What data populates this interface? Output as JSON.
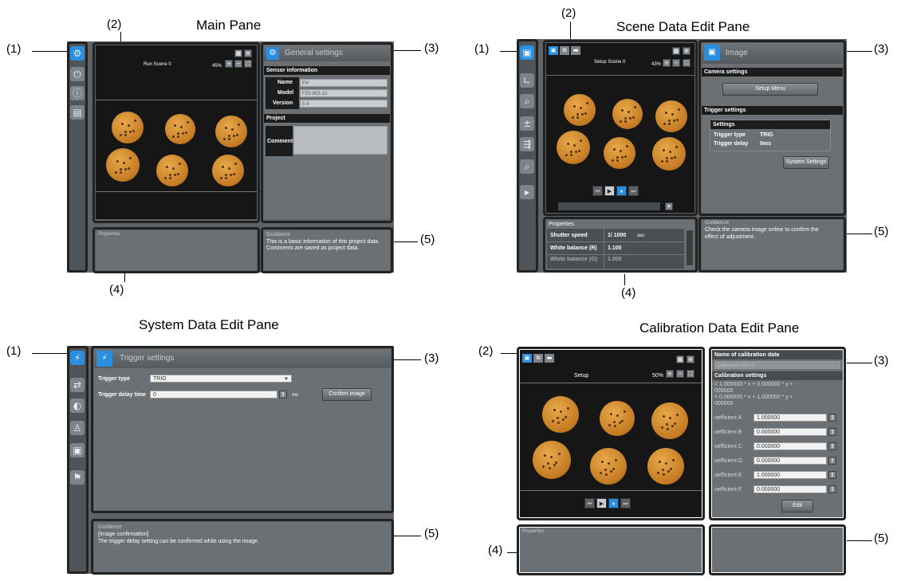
{
  "titles": {
    "main": "Main Pane",
    "scene": "Scene Data Edit Pane",
    "system": "System Data Edit Pane",
    "calib": "Calibration Data Edit Pane"
  },
  "callouts": {
    "c1": "(1)",
    "c2": "(2)",
    "c3": "(3)",
    "c4": "(4)",
    "c5": "(5)"
  },
  "main_pane": {
    "scene_label": "Run Scene 0",
    "zoom": "45%",
    "header": "General settings",
    "sensor_info": "Sensor information",
    "name_label": "Name",
    "name_val": "FH",
    "model_label": "Model",
    "model_val": "FZ5-803-10",
    "version_label": "Version",
    "version_val": "5.4",
    "project": "Project",
    "comment": "Comment",
    "properties": "Properties",
    "guidance_title": "Guidance",
    "guidance_text_1": "This is a basic information of this project data.",
    "guidance_text_2": "Comments are saved as project data."
  },
  "scene_pane": {
    "scene_label": "Setup Scene 0",
    "zoom": "43%",
    "header": "Image",
    "camera_settings": "Camera settings",
    "setup_menu": "Setup Menu",
    "trigger_settings": "Trigger settings",
    "settings": "Settings",
    "trigger_type_label": "Trigger type",
    "trigger_type_val": "TRIG",
    "trigger_delay_label": "Trigger delay",
    "trigger_delay_val": "0ms",
    "system_settings": "System Settings",
    "properties": "Properties",
    "shutter_label": "Shutter speed",
    "shutter_val": "1/ 1000",
    "shutter_unit": "sec",
    "wb_label": "White balance (R)",
    "wb_val": "1.100",
    "wb2_label": "White balance (G)",
    "wb2_val": "1.000",
    "guidance_title": "Guidance",
    "guidance_text_1": "Check the camera image online to confirm the",
    "guidance_text_2": "effect of adjustment."
  },
  "system_pane": {
    "header": "Trigger settings",
    "trigger_type_label": "Trigger type",
    "trigger_type_val": "TRIG",
    "trigger_delay_label": "Trigger delay time",
    "trigger_delay_val": "0",
    "unit": "ms",
    "confirm_image": "Confirm image",
    "guidance_title": "Guidance",
    "guidance_text_1": "[Image confirmation]",
    "guidance_text_2": "The trigger delay setting can be confirmed while using the image."
  },
  "calib_pane": {
    "scene_label": "Setup",
    "zoom": "50%",
    "name_header": "Name of calibration data",
    "name_val": "Calibration data 0",
    "calib_settings": "Calibration settings",
    "eq_1": "= 1.000000 * x + 0.000000 * y +",
    "eq_2": "000000",
    "eq_3": "= 0.000000 * x + 1.000000 * y +",
    "eq_4": "000000",
    "coeffs": [
      {
        "label": "oefficient A",
        "val": "1.000000"
      },
      {
        "label": "oefficient B",
        "val": "0.000000"
      },
      {
        "label": "oefficient C",
        "val": "0.000000"
      },
      {
        "label": "oefficient D",
        "val": "0.000000"
      },
      {
        "label": "oefficient E",
        "val": "1.000000"
      },
      {
        "label": "oefficient F",
        "val": "0.000000"
      }
    ],
    "edit": "Edit",
    "properties": "Properties"
  }
}
